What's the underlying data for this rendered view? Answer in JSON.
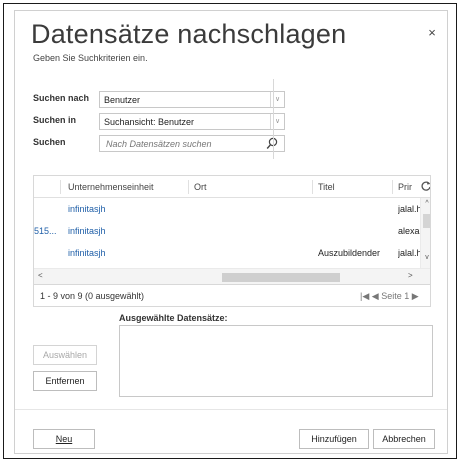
{
  "dialog": {
    "title": "Datensätze nachschlagen",
    "subtitle": "Geben Sie Suchkriterien ein.",
    "close": "×"
  },
  "form": {
    "search_for_label": "Suchen nach",
    "search_for_value": "Benutzer",
    "search_in_label": "Suchen in",
    "search_in_value": "Suchansicht: Benutzer",
    "search_label": "Suchen",
    "search_placeholder": "Nach Datensätzen suchen",
    "dropdown_arrow": "∨"
  },
  "grid": {
    "columns": [
      "Unternehmenseinheit",
      "Ort",
      "Titel",
      "Prir"
    ],
    "rows": [
      {
        "lead": "",
        "unit": "infinitasjh",
        "ort": "",
        "titel": "",
        "prim": "jalal.h"
      },
      {
        "lead": "515...",
        "unit": "infinitasjh",
        "ort": "",
        "titel": "",
        "prim": "alexan"
      },
      {
        "lead": "",
        "unit": "infinitasjh",
        "ort": "",
        "titel": "Auszubildender",
        "prim": "jalal.h"
      }
    ],
    "scroll_up": "^",
    "scroll_down": "v",
    "scroll_left": "<",
    "scroll_right": ">"
  },
  "footer": {
    "count": "1 - 9  von 9 (0 ausgewählt)",
    "first_page": "|◀",
    "prev_page": "◀",
    "page": "Seite 1",
    "next_page": "▶"
  },
  "selected": {
    "label": "Ausgewählte Datensätze:"
  },
  "buttons": {
    "select": "Auswählen",
    "remove": "Entfernen",
    "new": "Neu",
    "add": "Hinzufügen",
    "cancel": "Abbrechen"
  }
}
